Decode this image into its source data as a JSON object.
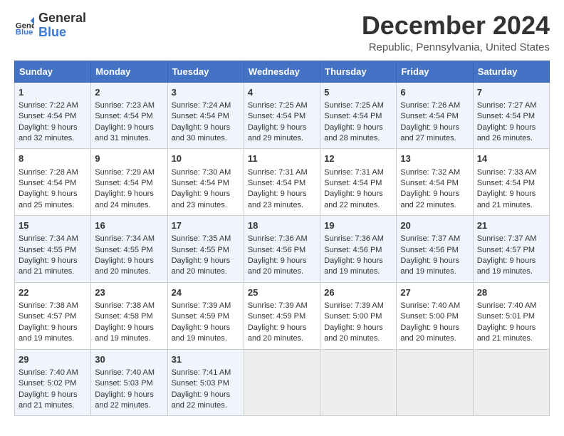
{
  "logo": {
    "line1": "General",
    "line2": "Blue"
  },
  "title": "December 2024",
  "subtitle": "Republic, Pennsylvania, United States",
  "headers": [
    "Sunday",
    "Monday",
    "Tuesday",
    "Wednesday",
    "Thursday",
    "Friday",
    "Saturday"
  ],
  "weeks": [
    [
      {
        "day": "1",
        "lines": [
          "Sunrise: 7:22 AM",
          "Sunset: 4:54 PM",
          "Daylight: 9 hours",
          "and 32 minutes."
        ]
      },
      {
        "day": "2",
        "lines": [
          "Sunrise: 7:23 AM",
          "Sunset: 4:54 PM",
          "Daylight: 9 hours",
          "and 31 minutes."
        ]
      },
      {
        "day": "3",
        "lines": [
          "Sunrise: 7:24 AM",
          "Sunset: 4:54 PM",
          "Daylight: 9 hours",
          "and 30 minutes."
        ]
      },
      {
        "day": "4",
        "lines": [
          "Sunrise: 7:25 AM",
          "Sunset: 4:54 PM",
          "Daylight: 9 hours",
          "and 29 minutes."
        ]
      },
      {
        "day": "5",
        "lines": [
          "Sunrise: 7:25 AM",
          "Sunset: 4:54 PM",
          "Daylight: 9 hours",
          "and 28 minutes."
        ]
      },
      {
        "day": "6",
        "lines": [
          "Sunrise: 7:26 AM",
          "Sunset: 4:54 PM",
          "Daylight: 9 hours",
          "and 27 minutes."
        ]
      },
      {
        "day": "7",
        "lines": [
          "Sunrise: 7:27 AM",
          "Sunset: 4:54 PM",
          "Daylight: 9 hours",
          "and 26 minutes."
        ]
      }
    ],
    [
      {
        "day": "8",
        "lines": [
          "Sunrise: 7:28 AM",
          "Sunset: 4:54 PM",
          "Daylight: 9 hours",
          "and 25 minutes."
        ]
      },
      {
        "day": "9",
        "lines": [
          "Sunrise: 7:29 AM",
          "Sunset: 4:54 PM",
          "Daylight: 9 hours",
          "and 24 minutes."
        ]
      },
      {
        "day": "10",
        "lines": [
          "Sunrise: 7:30 AM",
          "Sunset: 4:54 PM",
          "Daylight: 9 hours",
          "and 23 minutes."
        ]
      },
      {
        "day": "11",
        "lines": [
          "Sunrise: 7:31 AM",
          "Sunset: 4:54 PM",
          "Daylight: 9 hours",
          "and 23 minutes."
        ]
      },
      {
        "day": "12",
        "lines": [
          "Sunrise: 7:31 AM",
          "Sunset: 4:54 PM",
          "Daylight: 9 hours",
          "and 22 minutes."
        ]
      },
      {
        "day": "13",
        "lines": [
          "Sunrise: 7:32 AM",
          "Sunset: 4:54 PM",
          "Daylight: 9 hours",
          "and 22 minutes."
        ]
      },
      {
        "day": "14",
        "lines": [
          "Sunrise: 7:33 AM",
          "Sunset: 4:54 PM",
          "Daylight: 9 hours",
          "and 21 minutes."
        ]
      }
    ],
    [
      {
        "day": "15",
        "lines": [
          "Sunrise: 7:34 AM",
          "Sunset: 4:55 PM",
          "Daylight: 9 hours",
          "and 21 minutes."
        ]
      },
      {
        "day": "16",
        "lines": [
          "Sunrise: 7:34 AM",
          "Sunset: 4:55 PM",
          "Daylight: 9 hours",
          "and 20 minutes."
        ]
      },
      {
        "day": "17",
        "lines": [
          "Sunrise: 7:35 AM",
          "Sunset: 4:55 PM",
          "Daylight: 9 hours",
          "and 20 minutes."
        ]
      },
      {
        "day": "18",
        "lines": [
          "Sunrise: 7:36 AM",
          "Sunset: 4:56 PM",
          "Daylight: 9 hours",
          "and 20 minutes."
        ]
      },
      {
        "day": "19",
        "lines": [
          "Sunrise: 7:36 AM",
          "Sunset: 4:56 PM",
          "Daylight: 9 hours",
          "and 19 minutes."
        ]
      },
      {
        "day": "20",
        "lines": [
          "Sunrise: 7:37 AM",
          "Sunset: 4:56 PM",
          "Daylight: 9 hours",
          "and 19 minutes."
        ]
      },
      {
        "day": "21",
        "lines": [
          "Sunrise: 7:37 AM",
          "Sunset: 4:57 PM",
          "Daylight: 9 hours",
          "and 19 minutes."
        ]
      }
    ],
    [
      {
        "day": "22",
        "lines": [
          "Sunrise: 7:38 AM",
          "Sunset: 4:57 PM",
          "Daylight: 9 hours",
          "and 19 minutes."
        ]
      },
      {
        "day": "23",
        "lines": [
          "Sunrise: 7:38 AM",
          "Sunset: 4:58 PM",
          "Daylight: 9 hours",
          "and 19 minutes."
        ]
      },
      {
        "day": "24",
        "lines": [
          "Sunrise: 7:39 AM",
          "Sunset: 4:59 PM",
          "Daylight: 9 hours",
          "and 19 minutes."
        ]
      },
      {
        "day": "25",
        "lines": [
          "Sunrise: 7:39 AM",
          "Sunset: 4:59 PM",
          "Daylight: 9 hours",
          "and 20 minutes."
        ]
      },
      {
        "day": "26",
        "lines": [
          "Sunrise: 7:39 AM",
          "Sunset: 5:00 PM",
          "Daylight: 9 hours",
          "and 20 minutes."
        ]
      },
      {
        "day": "27",
        "lines": [
          "Sunrise: 7:40 AM",
          "Sunset: 5:00 PM",
          "Daylight: 9 hours",
          "and 20 minutes."
        ]
      },
      {
        "day": "28",
        "lines": [
          "Sunrise: 7:40 AM",
          "Sunset: 5:01 PM",
          "Daylight: 9 hours",
          "and 21 minutes."
        ]
      }
    ],
    [
      {
        "day": "29",
        "lines": [
          "Sunrise: 7:40 AM",
          "Sunset: 5:02 PM",
          "Daylight: 9 hours",
          "and 21 minutes."
        ]
      },
      {
        "day": "30",
        "lines": [
          "Sunrise: 7:40 AM",
          "Sunset: 5:03 PM",
          "Daylight: 9 hours",
          "and 22 minutes."
        ]
      },
      {
        "day": "31",
        "lines": [
          "Sunrise: 7:41 AM",
          "Sunset: 5:03 PM",
          "Daylight: 9 hours",
          "and 22 minutes."
        ]
      },
      null,
      null,
      null,
      null
    ]
  ]
}
